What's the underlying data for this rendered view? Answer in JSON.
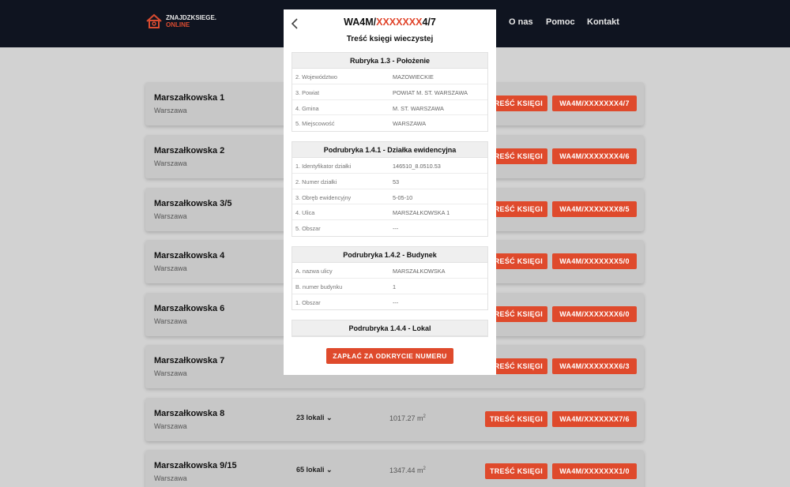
{
  "header": {
    "logo_line1": "ZNAJDZKSIEGE.",
    "logo_line2": "ONLINE",
    "nav": [
      "O nas",
      "Pomoc",
      "Kontakt"
    ]
  },
  "listing": [
    {
      "street": "Marszałkowska 1",
      "city": "Warszawa",
      "units": "",
      "area": "",
      "content_label": "TREŚĆ KSIĘGI",
      "number": "WA4M/XXXXXXX4/7"
    },
    {
      "street": "Marszałkowska 2",
      "city": "Warszawa",
      "units": "",
      "area": "",
      "content_label": "TREŚĆ KSIĘGI",
      "number": "WA4M/XXXXXXX4/6"
    },
    {
      "street": "Marszałkowska 3/5",
      "city": "Warszawa",
      "units": "",
      "area": "",
      "content_label": "TREŚĆ KSIĘGI",
      "number": "WA4M/XXXXXXX8/5"
    },
    {
      "street": "Marszałkowska 4",
      "city": "Warszawa",
      "units": "",
      "area": "",
      "content_label": "TREŚĆ KSIĘGI",
      "number": "WA4M/XXXXXXX5/0"
    },
    {
      "street": "Marszałkowska 6",
      "city": "Warszawa",
      "units": "",
      "area": "",
      "content_label": "TREŚĆ KSIĘGI",
      "number": "WA4M/XXXXXXX6/0"
    },
    {
      "street": "Marszałkowska 7",
      "city": "Warszawa",
      "units": "",
      "area": "",
      "content_label": "TREŚĆ KSIĘGI",
      "number": "WA4M/XXXXXXX6/3"
    },
    {
      "street": "Marszałkowska 8",
      "city": "Warszawa",
      "units": "23 lokali",
      "area": "1017.27 m",
      "content_label": "TREŚĆ KSIĘGI",
      "number": "WA4M/XXXXXXX7/6"
    },
    {
      "street": "Marszałkowska 9/15",
      "city": "Warszawa",
      "units": "65 lokali",
      "area": "1347.44 m",
      "content_label": "TREŚĆ KSIĘGI",
      "number": "WA4M/XXXXXXX1/0"
    }
  ],
  "modal": {
    "title_prefix": "WA4M/",
    "title_masked": "XXXXXXX",
    "title_suffix": "4/7",
    "subtitle": "Treść księgi wieczystej",
    "sections": [
      {
        "heading": "Rubryka 1.3 - Położenie",
        "rows": [
          {
            "k": "2. Województwo",
            "v": "MAZOWIECKIE"
          },
          {
            "k": "3. Powiat",
            "v": "POWIAT M. ST. WARSZAWA"
          },
          {
            "k": "4. Gmina",
            "v": "M. ST. WARSZAWA"
          },
          {
            "k": "5. Miejscowość",
            "v": "WARSZAWA"
          }
        ]
      },
      {
        "heading": "Podrubryka 1.4.1 - Działka ewidencyjna",
        "rows": [
          {
            "k": "1. Identyfikator działki",
            "v": "146510_8.0510.53"
          },
          {
            "k": "2. Numer działki",
            "v": "53"
          },
          {
            "k": "3. Obręb ewidencyjny",
            "v": "5-05-10"
          },
          {
            "k": "4. Ulica",
            "v": "MARSZAŁKOWSKA 1"
          },
          {
            "k": "5. Obszar",
            "v": "---"
          }
        ]
      },
      {
        "heading": "Podrubryka 1.4.2 - Budynek",
        "rows": [
          {
            "k": "A. nazwa ulicy",
            "v": "MARSZAŁKOWSKA"
          },
          {
            "k": "B. numer budynku",
            "v": "1"
          },
          {
            "k": "1. Obszar",
            "v": "---"
          }
        ]
      },
      {
        "heading": "Podrubryka 1.4.4 - Lokal",
        "rows": []
      }
    ],
    "pay_label": "ZAPŁAĆ ZA ODKRYCIE NUMERU"
  }
}
